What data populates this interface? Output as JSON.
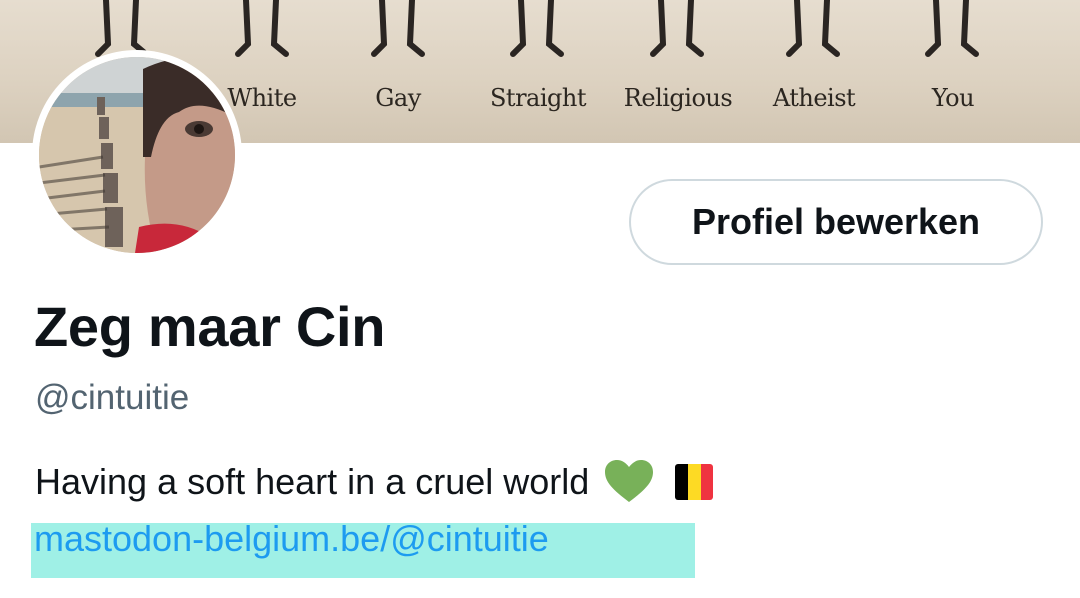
{
  "banner": {
    "labels": [
      "White",
      "Gay",
      "Straight",
      "Religious",
      "Atheist",
      "You"
    ]
  },
  "profile": {
    "edit_button": "Profiel bewerken",
    "display_name": "Zeg maar Cin",
    "handle": "@cintuitie",
    "bio_text": "Having a soft heart in a cruel world",
    "bio_emoji": [
      "green-heart-icon",
      "belgium-flag-icon"
    ],
    "link": "mastodon-belgium.be/@cintuitie"
  },
  "colors": {
    "link": "#1d9bf0",
    "link_highlight": "#9ff0e6",
    "heart": "#78b159",
    "flag": [
      "#000000",
      "#fdda24",
      "#ef3340"
    ]
  }
}
